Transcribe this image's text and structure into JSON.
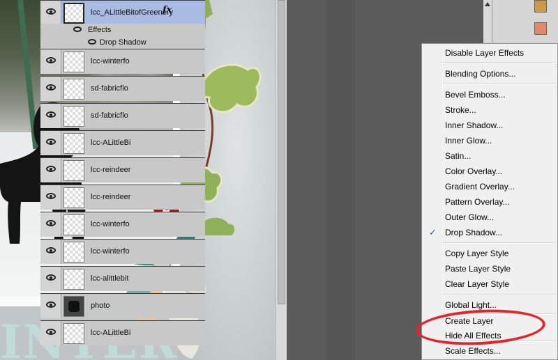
{
  "canvas": {
    "title_text": "INTER"
  },
  "layers": [
    {
      "name": "lcc_ALittleBitofGreenery",
      "selected": true,
      "fx": "fx"
    },
    {
      "name": "lcc-winterfo"
    },
    {
      "name": "sd-fabricflo"
    },
    {
      "name": "sd-fabricflo"
    },
    {
      "name": "lcc-ALittleBi"
    },
    {
      "name": "lcc-reindeer"
    },
    {
      "name": "lcc-reindeer"
    },
    {
      "name": "lcc-winterfo"
    },
    {
      "name": "lcc-winterfo"
    },
    {
      "name": "lcc-alittlebit"
    },
    {
      "name": "photo",
      "photo": true
    },
    {
      "name": "lcc-ALittleBi"
    }
  ],
  "effects": {
    "label": "Effects",
    "drop_shadow": "Drop Shadow"
  },
  "menu": {
    "disable_effects": "Disable Layer Effects",
    "blending": "Blending Options...",
    "bevel": "Bevel  Emboss...",
    "stroke": "Stroke...",
    "inner_shadow": "Inner Shadow...",
    "inner_glow": "Inner Glow...",
    "satin": "Satin...",
    "color_overlay": "Color Overlay...",
    "gradient_overlay": "Gradient Overlay...",
    "pattern_overlay": "Pattern Overlay...",
    "outer_glow": "Outer Glow...",
    "drop_shadow": "Drop Shadow...",
    "copy_style": "Copy Layer Style",
    "paste_style": "Paste Layer Style",
    "clear_style": "Clear Layer Style",
    "global_light": "Global Light...",
    "create_layer": "Create Layer",
    "hide_all": "Hide All Effects",
    "scale": "Scale Effects...",
    "check_mark": "✓"
  },
  "colors": {
    "annotation": "#e5232a",
    "selected_layer": "#a9bbe3"
  }
}
